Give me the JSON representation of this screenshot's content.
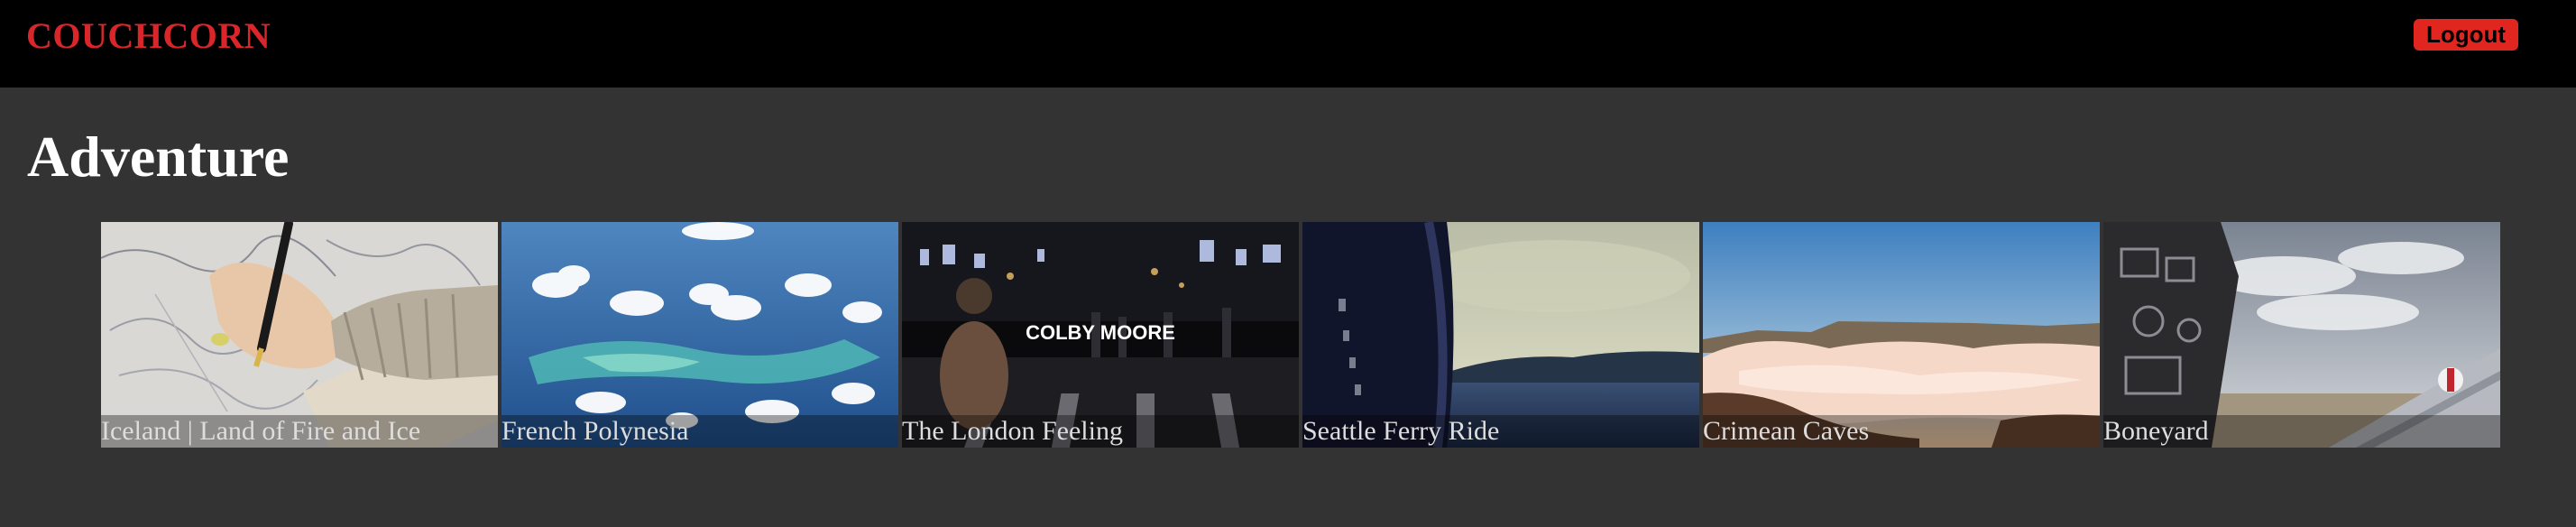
{
  "app": {
    "brand": "COUCHCORN",
    "logout_label": "Logout"
  },
  "colors": {
    "brand": "#d8262a",
    "logout_bg": "#e0261e",
    "page_bg": "#333333",
    "topbar_bg": "#000000"
  },
  "section": {
    "title": "Adventure"
  },
  "videos": [
    {
      "title": "Iceland | Land of Fire and Ice"
    },
    {
      "title": "French Polynesia"
    },
    {
      "title": "The London Feeling",
      "overlay_text": "COLBY MOORE"
    },
    {
      "title": "Seattle Ferry Ride"
    },
    {
      "title": "Crimean Caves"
    },
    {
      "title": "Boneyard"
    }
  ]
}
